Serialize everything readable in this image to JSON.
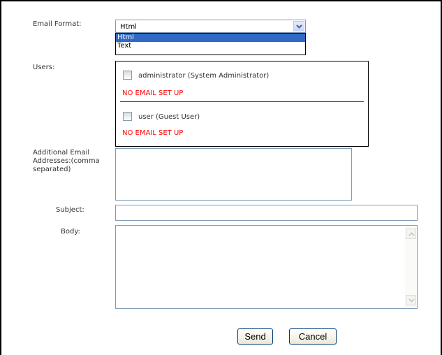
{
  "form": {
    "email_format_label": "Email Format:",
    "email_format_value": "Html",
    "email_format_options": [
      "Html",
      "Text"
    ],
    "users_label": "Users:",
    "users": [
      {
        "name": "administrator (System Administrator)",
        "status": "NO EMAIL SET UP"
      },
      {
        "name": "user (Guest User)",
        "status": "NO EMAIL SET UP"
      }
    ],
    "additional_label_line1": "Additional Email",
    "additional_label_line2": "Addresses:(comma",
    "additional_label_line3": "separated)",
    "subject_label": "Subject:",
    "body_label": "Body:",
    "send_label": "Send",
    "cancel_label": "Cancel"
  },
  "colors": {
    "warning": "#ff0000",
    "divider": "#990099",
    "selection": "#316ac5"
  }
}
